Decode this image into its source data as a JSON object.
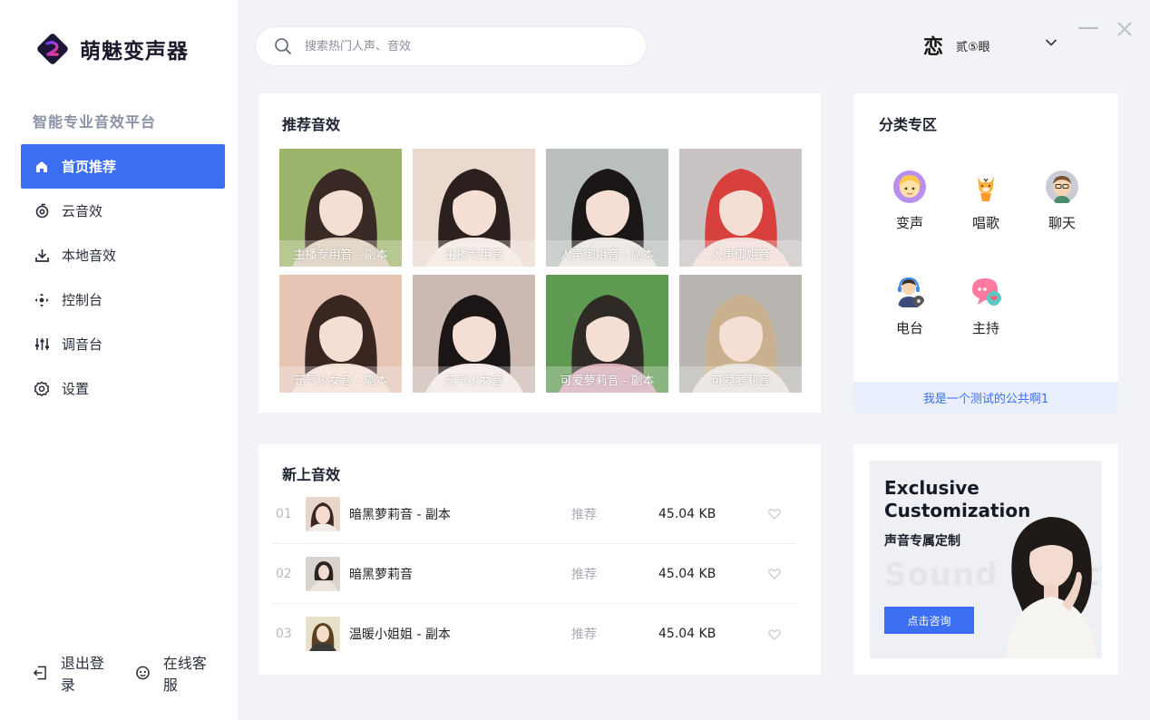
{
  "app": {
    "name": "萌魅变声器",
    "tagline": "智能专业音效平台"
  },
  "nav": [
    {
      "label": "首页推荐",
      "icon": "home-icon",
      "active": true
    },
    {
      "label": "云音效",
      "icon": "cloud-sound-icon",
      "active": false
    },
    {
      "label": "本地音效",
      "icon": "download-icon",
      "active": false
    },
    {
      "label": "控制台",
      "icon": "gamepad-icon",
      "active": false
    },
    {
      "label": "调音台",
      "icon": "mixer-icon",
      "active": false
    },
    {
      "label": "设置",
      "icon": "gear-icon",
      "active": false
    }
  ],
  "footer": {
    "logout": "退出登录",
    "support": "在线客服"
  },
  "search": {
    "placeholder": "搜索热门人声、音效",
    "value": ""
  },
  "user": {
    "avatar_glyph": "恋",
    "name": "贰⑤眼"
  },
  "recommended": {
    "title": "推荐音效",
    "items": [
      {
        "label": "主播专用音 - 副本",
        "colors": [
          "#9bb36a",
          "#d8c9b4",
          "#3a2a25"
        ]
      },
      {
        "label": "主播专用音",
        "colors": [
          "#e9d9cf",
          "#f3e6de",
          "#2b201d"
        ]
      },
      {
        "label": "人声御姐音 - 副本",
        "colors": [
          "#b9c0bc",
          "#e8e2dc",
          "#1b1716"
        ]
      },
      {
        "label": "人声御姐音",
        "colors": [
          "#c9c3c3",
          "#f2dcd5",
          "#d8403e"
        ]
      },
      {
        "label": "元气少女音 - 副本",
        "colors": [
          "#e7c4b4",
          "#f3ddd2",
          "#3a2621"
        ]
      },
      {
        "label": "元气少女音",
        "colors": [
          "#cbb9b2",
          "#f1e6e4",
          "#1c1515"
        ]
      },
      {
        "label": "可爱萝莉音 - 副本",
        "colors": [
          "#5f9a52",
          "#d5a8b4",
          "#2f2a26"
        ]
      },
      {
        "label": "可爱萝莉音",
        "colors": [
          "#b9b6b2",
          "#e7e0da",
          "#c9b18f"
        ]
      }
    ]
  },
  "categories": {
    "title": "分类专区",
    "items": [
      {
        "label": "变声",
        "icon": "girl-avatar-icon"
      },
      {
        "label": "唱歌",
        "icon": "tiger-mascot-icon"
      },
      {
        "label": "聊天",
        "icon": "man-avatar-icon"
      },
      {
        "label": "电台",
        "icon": "headset-user-icon"
      },
      {
        "label": "主持",
        "icon": "speech-bubble-icon"
      }
    ],
    "notice": "我是一个测试的公共啊1"
  },
  "new_sounds": {
    "title": "新上音效",
    "items": [
      {
        "num": "01",
        "name": "暗黑萝莉音 - 副本",
        "tag": "推荐",
        "size": "45.04 KB"
      },
      {
        "num": "02",
        "name": "暗黑萝莉音",
        "tag": "推荐",
        "size": "45.04 KB"
      },
      {
        "num": "03",
        "name": "温暖小姐姐 - 副本",
        "tag": "推荐",
        "size": "45.04 KB"
      }
    ]
  },
  "promo": {
    "heading_line1": "Exclusive",
    "heading_line2": "Customization",
    "subtitle": "声音专属定制",
    "ghost": "Sound Effect",
    "button": "点击咨询"
  },
  "colors": {
    "accent": "#3b6ef0",
    "background": "#f2f3f7"
  }
}
